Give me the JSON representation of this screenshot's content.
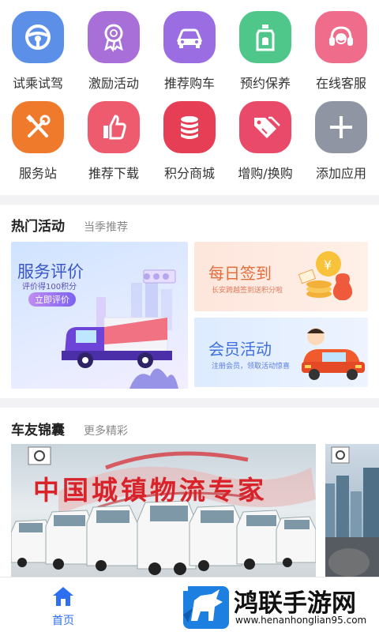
{
  "grid": [
    {
      "label": "试乘试驾",
      "icon": "steering-wheel-icon",
      "color": "#5c8fe8"
    },
    {
      "label": "激励活动",
      "icon": "award-ribbon-icon",
      "color": "#a86fd8"
    },
    {
      "label": "推荐购车",
      "icon": "car-icon",
      "color": "#9a6ee2"
    },
    {
      "label": "预约保养",
      "icon": "oil-bottle-icon",
      "color": "#4fc78a"
    },
    {
      "label": "在线客服",
      "icon": "headset-icon",
      "color": "#ef6d8a"
    },
    {
      "label": "服务站",
      "icon": "tools-icon",
      "color": "#f07a2c"
    },
    {
      "label": "推荐下载",
      "icon": "thumbs-up-icon",
      "color": "#ee5a6e"
    },
    {
      "label": "积分商城",
      "icon": "coins-stack-icon",
      "color": "#e63f55"
    },
    {
      "label": "增购/换购",
      "icon": "tags-icon",
      "color": "#ea4a6a"
    },
    {
      "label": "添加应用",
      "icon": "plus-icon",
      "color": "#9095a4"
    }
  ],
  "hot": {
    "title": "热门活动",
    "subtitle": "当季推荐",
    "card_big": {
      "title": "服务评价",
      "desc": "评价得100积分",
      "button": "立即评价"
    },
    "card_sign": {
      "title": "每日签到",
      "desc": "长安跨越签到送积分啦"
    },
    "card_member": {
      "title": "会员活动",
      "desc": "注册会员，领取活动惊喜"
    }
  },
  "friends": {
    "title": "车友锦囊",
    "subtitle": "更多精彩",
    "banner_title": "中国城镇物流专家"
  },
  "tabbar": {
    "home_label": "首页",
    "home_icon": "home-icon",
    "accent": "#2d6ff0"
  },
  "watermark": {
    "title": "鸿联手游网",
    "url": "www.henanhonglian95.com"
  }
}
